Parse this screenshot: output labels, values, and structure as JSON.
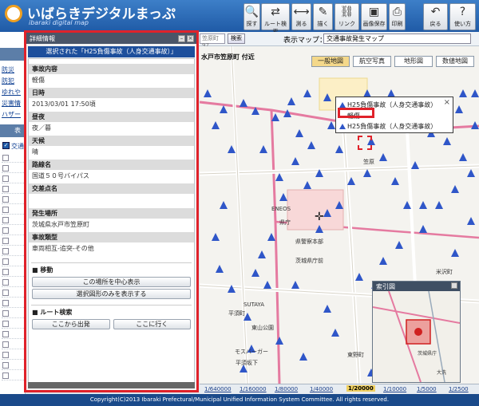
{
  "header": {
    "logo_text": "いばらきデジタルまっぷ",
    "logo_sub": "ibaraki digital map",
    "toolbar": [
      {
        "label": "探す",
        "icon": "search-icon",
        "glyph": "🔍"
      },
      {
        "label": "ルート検索",
        "icon": "route-icon",
        "glyph": "⇄"
      },
      {
        "label": "測る",
        "icon": "measure-icon",
        "glyph": "⟷"
      },
      {
        "label": "描く",
        "icon": "draw-icon",
        "glyph": "✎"
      },
      {
        "label": "リンク",
        "icon": "link-icon",
        "glyph": "⛓"
      },
      {
        "label": "画像保存",
        "icon": "save-image-icon",
        "glyph": "▣"
      },
      {
        "label": "印刷",
        "icon": "print-icon",
        "glyph": "⎙"
      },
      {
        "label": "戻る",
        "icon": "back-icon",
        "glyph": "↶"
      },
      {
        "label": "使い方",
        "icon": "help-icon",
        "glyph": "?"
      }
    ]
  },
  "subbar": {
    "left_tab": "トッ",
    "address_fragment": "笠原町97",
    "search_button": "検索",
    "display_map_label": "表示マップ：",
    "display_map_value": "交通事故発生マップ"
  },
  "left_strip": {
    "items": [
      "防災",
      "防犯",
      "ゆれや",
      "災害情",
      "ハザー"
    ],
    "section_label": "表",
    "layer_label": "交通"
  },
  "panel": {
    "title": "詳細情報",
    "selected": "選択された「H25負傷事故（人身交通事故）」",
    "fields": [
      {
        "label": "事故内容",
        "value": "軽傷"
      },
      {
        "label": "日時",
        "value": "2013/03/01 17:50頃"
      },
      {
        "label": "昼夜",
        "value": "夜／暮"
      },
      {
        "label": "天候",
        "value": "晴"
      },
      {
        "label": "路線名",
        "value": "国道５０号バイパス"
      },
      {
        "label": "交差点名",
        "value": ""
      }
    ],
    "fields2": [
      {
        "label": "発生場所",
        "value": "茨城県水戸市笠原町"
      },
      {
        "label": "事故類型",
        "value": "車両相互-追突-その他"
      }
    ],
    "move_section": "移動",
    "center_button": "この場所を中心表示",
    "selection_only_button": "選択図形のみを表示する",
    "route_section": "ルート検索",
    "from_button": "ここから出発",
    "to_button": "ここに行く"
  },
  "map": {
    "location_label": "水戸市笠原町 付近",
    "tabs": [
      "一般地図",
      "航空写真",
      "地形図",
      "数値地図"
    ],
    "active_tab": "一般地図",
    "labels": [
      "ENEOS",
      "県庁",
      "県警察本部",
      "米沢町",
      "平須町",
      "東野町",
      "SUTAYA",
      "モスバーガー",
      "東山公園",
      "茨城県庁前",
      "平須坂下",
      "笠原"
    ],
    "popup": {
      "row1": "H25負傷事故（人身交通事故）",
      "row2": "軽傷",
      "row3": "H25負傷事故（人身交通事故）",
      "close": "×"
    },
    "index_map": {
      "title": "索引図",
      "labels": [
        "茨城県庁",
        "大洗"
      ]
    },
    "accent_marker_color": "#2f56c8",
    "highlight_color": "#e0222a"
  },
  "scale": {
    "items": [
      "1/640000",
      "1/160000",
      "1/80000",
      "1/40000",
      "1/20000",
      "1/10000",
      "1/5000",
      "1/2500"
    ],
    "current": "1/20000"
  },
  "footer": {
    "copyright": "Copyright(C)2013 Ibaraki Prefectural/Municipal Unified Information System Committee. All rights reserved."
  }
}
